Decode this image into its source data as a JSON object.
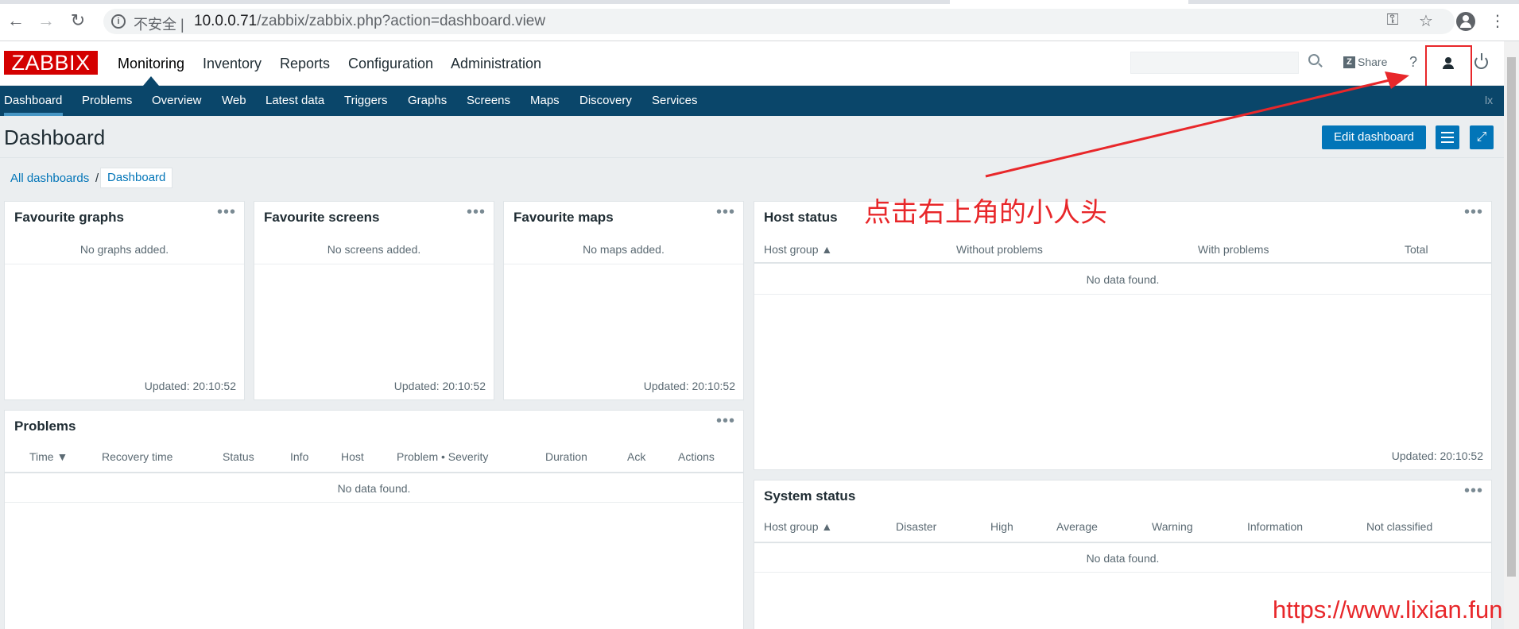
{
  "browser": {
    "insecure_label": "不安全 |",
    "url_host": "10.0.0.71",
    "url_path": "/zabbix/zabbix.php?action=dashboard.view"
  },
  "header": {
    "logo": "ZABBIX",
    "menu": [
      "Monitoring",
      "Inventory",
      "Reports",
      "Configuration",
      "Administration"
    ],
    "share_label": "Share",
    "help_label": "?"
  },
  "submenu": {
    "items": [
      "Dashboard",
      "Problems",
      "Overview",
      "Web",
      "Latest data",
      "Triggers",
      "Graphs",
      "Screens",
      "Maps",
      "Discovery",
      "Services"
    ],
    "right_text": "lx"
  },
  "page": {
    "title": "Dashboard",
    "edit_label": "Edit dashboard",
    "breadcrumb_all": "All dashboards",
    "breadcrumb_sep": "/",
    "breadcrumb_current": "Dashboard"
  },
  "widgets": {
    "fav_graphs": {
      "title": "Favourite graphs",
      "message": "No graphs added.",
      "updated": "Updated: 20:10:52"
    },
    "fav_screens": {
      "title": "Favourite screens",
      "message": "No screens added.",
      "updated": "Updated: 20:10:52"
    },
    "fav_maps": {
      "title": "Favourite maps",
      "message": "No maps added.",
      "updated": "Updated: 20:10:52"
    },
    "host_status": {
      "title": "Host status",
      "columns": [
        "Host group ▲",
        "Without problems",
        "With problems",
        "Total"
      ],
      "message": "No data found.",
      "updated": "Updated: 20:10:52"
    },
    "problems": {
      "title": "Problems",
      "columns": [
        "Time ▼",
        "Recovery time",
        "Status",
        "Info",
        "Host",
        "Problem • Severity",
        "Duration",
        "Ack",
        "Actions"
      ],
      "message": "No data found."
    },
    "system_status": {
      "title": "System status",
      "columns": [
        "Host group ▲",
        "Disaster",
        "High",
        "Average",
        "Warning",
        "Information",
        "Not classified"
      ],
      "message": "No data found."
    }
  },
  "widget_menu_label": "•••",
  "annotation": "点击右上角的小人头",
  "watermark": "https://www.lixian.fun",
  "colors": {
    "header_blue": "#0a466a",
    "button_blue": "#0275b8",
    "logo_red": "#d40000",
    "annotation_red": "#e8272a"
  }
}
